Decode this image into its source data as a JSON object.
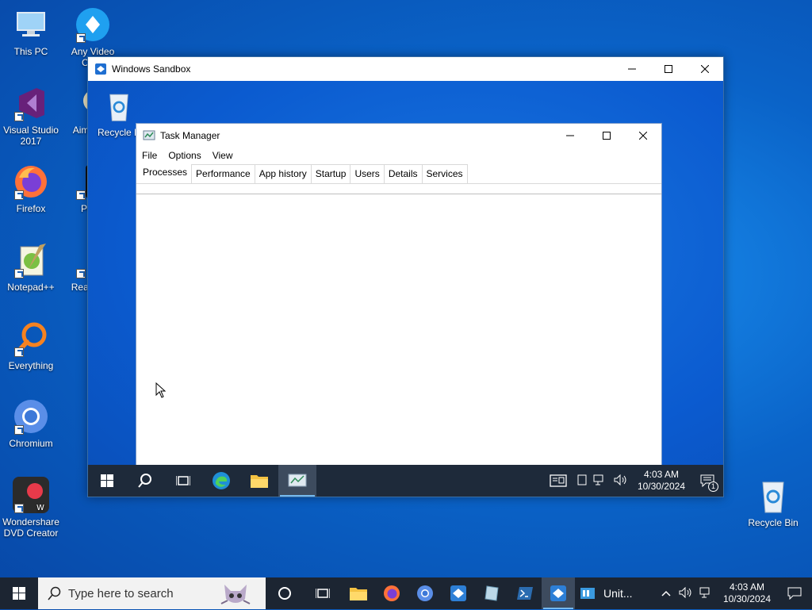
{
  "desktop": {
    "icons": [
      {
        "label": "This PC"
      },
      {
        "label": "Any Video Conv"
      },
      {
        "label": "Visual Studio 2017"
      },
      {
        "label": "Aimi Vide"
      },
      {
        "label": "Firefox"
      },
      {
        "label": "Powe"
      },
      {
        "label": "Notepad++"
      },
      {
        "label": "Reali Vide"
      },
      {
        "label": "Everything"
      },
      {
        "label": "Chromium"
      },
      {
        "label": "Wondershare DVD Creator"
      },
      {
        "label": "Recycle Bin"
      }
    ]
  },
  "sandbox": {
    "title": "Windows Sandbox",
    "desktop_icon_label": "Recycle B",
    "taskbar": {
      "time": "4:03 AM",
      "date": "10/30/2024",
      "notification_count": "1"
    }
  },
  "taskmgr": {
    "title": "Task Manager",
    "menu": [
      "File",
      "Options",
      "View"
    ],
    "tabs": [
      "Processes",
      "Performance",
      "App history",
      "Startup",
      "Users",
      "Details",
      "Services"
    ],
    "active_tab": "Processes"
  },
  "host_taskbar": {
    "search_placeholder": "Type here to search",
    "app_label": "Unit...",
    "time": "4:03 AM",
    "date": "10/30/2024"
  }
}
